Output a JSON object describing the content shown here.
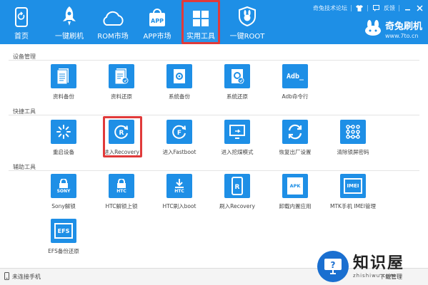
{
  "topbar": {
    "nav": [
      {
        "label": "首页",
        "icon": "phone-icon"
      },
      {
        "label": "一键刷机",
        "icon": "rocket-icon"
      },
      {
        "label": "ROM市场",
        "icon": "cloud-icon"
      },
      {
        "label": "APP市场",
        "icon": "shopping-bag-icon"
      },
      {
        "label": "实用工具",
        "icon": "grid-icon",
        "selected": true
      },
      {
        "label": "一键ROOT",
        "icon": "rabbit-shield-icon"
      }
    ],
    "util_links": {
      "forum": "奇兔技术论坛",
      "feedback": "反馈"
    },
    "brand": {
      "name": "奇兔刷机",
      "url": "www.7to.cn"
    },
    "accent": "#1e8fe6",
    "highlight": "#e03a3a"
  },
  "sections": [
    {
      "title": "设备管理",
      "tools": [
        {
          "label": "资料备份",
          "icon": "document-icon"
        },
        {
          "label": "资料还原",
          "icon": "document-restore-icon"
        },
        {
          "label": "系统备份",
          "icon": "system-backup-icon"
        },
        {
          "label": "系统还原",
          "icon": "system-restore-icon"
        },
        {
          "label": "Adb命令行",
          "icon": "adb-terminal-icon",
          "tile_text": "Adb_"
        }
      ]
    },
    {
      "title": "快捷工具",
      "tools": [
        {
          "label": "重启设备",
          "icon": "restart-icon"
        },
        {
          "label": "进入Recovery",
          "icon": "recovery-icon",
          "highlighted": true
        },
        {
          "label": "进入Fastboot",
          "icon": "fastboot-icon"
        },
        {
          "label": "进入挖煤模式",
          "icon": "download-mode-icon"
        },
        {
          "label": "恢复出厂设置",
          "icon": "factory-reset-icon"
        },
        {
          "label": "清除锁屏密码",
          "icon": "pattern-lock-icon"
        }
      ]
    },
    {
      "title": "辅助工具",
      "tools": [
        {
          "label": "Sony解锁",
          "icon": "sony-unlock-icon",
          "tile_text": "SONY"
        },
        {
          "label": "HTC解锁上锁",
          "icon": "htc-unlock-icon",
          "tile_text": "HTC"
        },
        {
          "label": "HTC刷入boot",
          "icon": "htc-boot-icon",
          "tile_text": "HTC"
        },
        {
          "label": "刷入Recovery",
          "icon": "flash-recovery-icon"
        },
        {
          "label": "卸载内置应用",
          "icon": "apk-uninstall-icon",
          "tile_text": "APK"
        },
        {
          "label": "MTK手机 IMEI管理",
          "icon": "imei-icon",
          "tile_text": "IMEI"
        },
        {
          "label": "EFS备份还原",
          "icon": "efs-icon",
          "tile_text": "EFS"
        }
      ]
    }
  ],
  "statusbar": {
    "connection": "未连接手机",
    "download_manager": "下载管理"
  },
  "watermark": {
    "text": "知识屋",
    "url": "zhishiwu.com"
  }
}
